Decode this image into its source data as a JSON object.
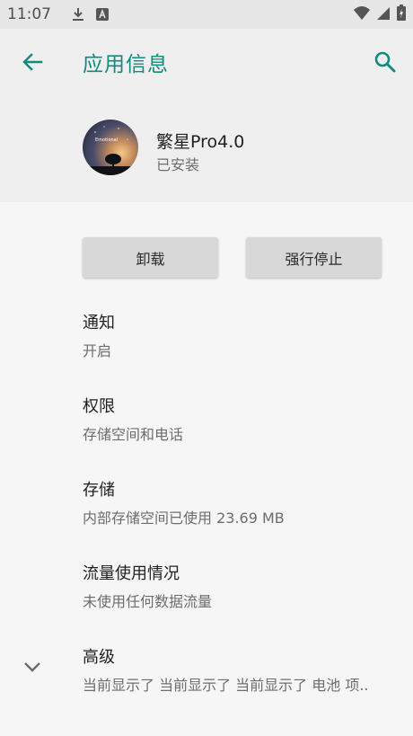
{
  "status_bar": {
    "time": "11:07",
    "left_icons": [
      "download-icon",
      "keyboard-a-icon"
    ],
    "right_icons": [
      "wifi-icon",
      "signal-icon",
      "battery-charging-icon"
    ]
  },
  "app_bar": {
    "title": "应用信息",
    "accent_color": "#138a7e"
  },
  "app": {
    "name": "繁星Pro4.0",
    "status": "已安装",
    "icon_text": "Emotional"
  },
  "buttons": {
    "uninstall": "卸载",
    "force_stop": "强行停止"
  },
  "settings": [
    {
      "title": "通知",
      "summary": "开启"
    },
    {
      "title": "权限",
      "summary": "存储空间和电话"
    },
    {
      "title": "存储",
      "summary": "内部存储空间已使用 23.69 MB"
    },
    {
      "title": "流量使用情况",
      "summary": "未使用任何数据流量"
    },
    {
      "title": "高级",
      "summary": "当前显示了 当前显示了 当前显示了 电池 项.."
    }
  ]
}
